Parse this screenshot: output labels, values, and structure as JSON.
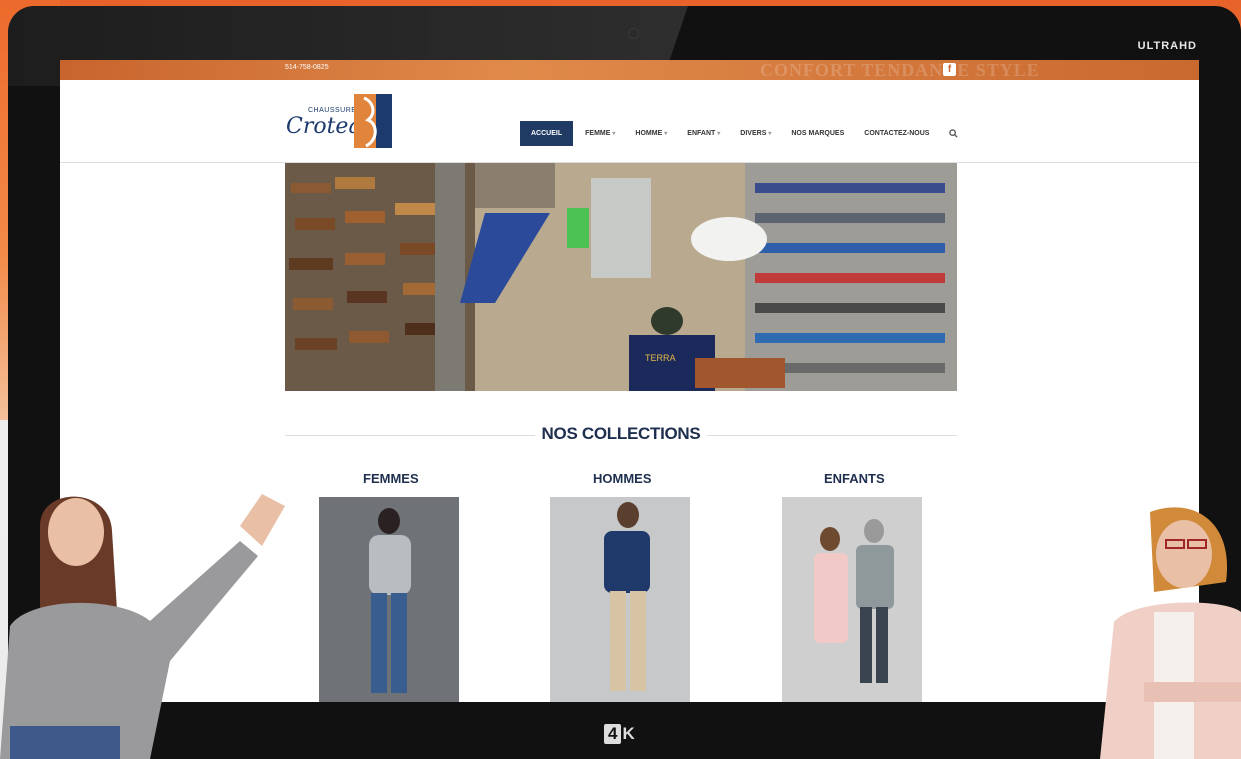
{
  "device": {
    "badge_top": "ULTRAHD",
    "badge_bottom_box": "4",
    "badge_bottom_text": "K"
  },
  "site": {
    "topbar": {
      "phone": "514-758-0825",
      "slogan": "CONFORT TENDANCE STYLE"
    },
    "logo": {
      "small": "CHAUSSURES",
      "script": "Croteau"
    },
    "nav": [
      {
        "label": "ACCUEIL",
        "active": true,
        "dropdown": false
      },
      {
        "label": "FEMME",
        "active": false,
        "dropdown": true
      },
      {
        "label": "HOMME",
        "active": false,
        "dropdown": true
      },
      {
        "label": "ENFANT",
        "active": false,
        "dropdown": true
      },
      {
        "label": "DIVERS",
        "active": false,
        "dropdown": true
      },
      {
        "label": "NOS MARQUES",
        "active": false,
        "dropdown": false
      },
      {
        "label": "CONTACTEZ-NOUS",
        "active": false,
        "dropdown": false
      }
    ],
    "collections_title": "NOS COLLECTIONS",
    "collections": [
      {
        "label": "FEMMES"
      },
      {
        "label": "HOMMES"
      },
      {
        "label": "ENFANTS"
      }
    ],
    "hero_cap_text": "TERRA"
  },
  "colors": {
    "accent_navy": "#1f3a63",
    "topbar_orange": "#d4793e",
    "heading": "#1f2f4f"
  },
  "icons": [
    "facebook-icon",
    "search-icon",
    "chevron-down-icon"
  ]
}
